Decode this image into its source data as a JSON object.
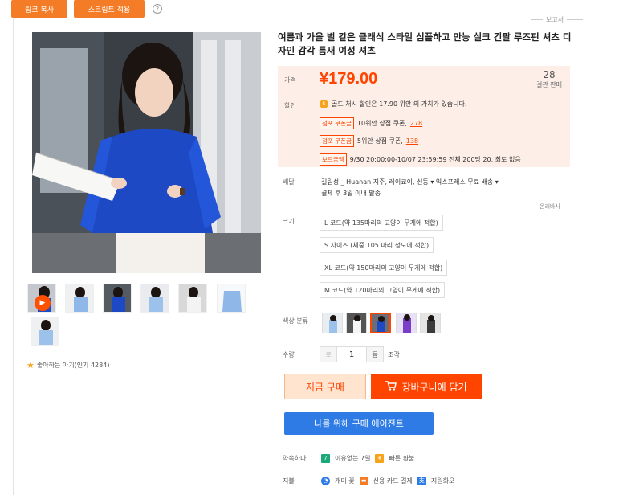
{
  "toolbar": {
    "copy_link": "링크 복사",
    "script_apply": "스크립트 적용",
    "help": "?"
  },
  "report": "보고서",
  "product": {
    "title": "여름과 가을 벌 같은 클래식 스타일 심플하고 만능 실크 긴팔 루즈핀 셔츠 디자인 감각 틈새 여성 셔츠"
  },
  "favorite": {
    "label": "좋아하는 아기(인기 4284)"
  },
  "price": {
    "label": "가격",
    "value": "¥179.00",
    "sold_count": "28",
    "sold_label": "걸관 판매"
  },
  "promo": {
    "label": "할인",
    "coin_line": "골드 처시 할인은 17.90 위안 의 가치가 있습니다.",
    "tag1": "점포 쿠폰금",
    "line1": "10위안 상점 쿠폰,",
    "amount1": "278",
    "tag2": "점포 쿠폰금",
    "line2": "5위안 상점 쿠폰,",
    "amount2": "138",
    "tag3": "보드금액",
    "line3": "9/30 20:00:00-10/07 23:59:59 전체 200당 20, 최도 없음"
  },
  "delivery": {
    "label": "배달",
    "line1": "길림성 _ Huanan 지주, 레이쿄이, 신등 ▾    익스프레스 무료 배송 ▾",
    "line2": "결제 후 3일 이내 발송",
    "extra": "온래바사"
  },
  "size": {
    "label": "크기",
    "options": [
      "L 코드(약 135마리의 고양이 무게에 적합)",
      "S 사이즈 (체중 105 마리 정도에 적합)",
      "XL 코드(약 150마리의 고양이 무게에 적합)",
      "M 코드(약 120마리의 고양이 무게에 적합)"
    ]
  },
  "color": {
    "label": "색상 분류"
  },
  "quantity": {
    "label": "수량",
    "minus": "로",
    "value": "1",
    "plus": "등",
    "unit": "조각"
  },
  "actions": {
    "buy_now": "지금 구매",
    "add_cart": "장바구니에 담기",
    "agent": "나를 위해 구매 에이전트"
  },
  "services": {
    "promise_label": "약속하다",
    "promise1": "이유없는 7일",
    "promise2": "빠른 환불",
    "payment_label": "지불",
    "pay1": "개미 꽃",
    "pay2": "신용 카드 결제",
    "pay3": "지원화오"
  },
  "colors": {
    "accent": "#ff4400",
    "orange_button": "#f57c26",
    "blue_button": "#2f7be5",
    "price_bg": "#fdeee7"
  }
}
